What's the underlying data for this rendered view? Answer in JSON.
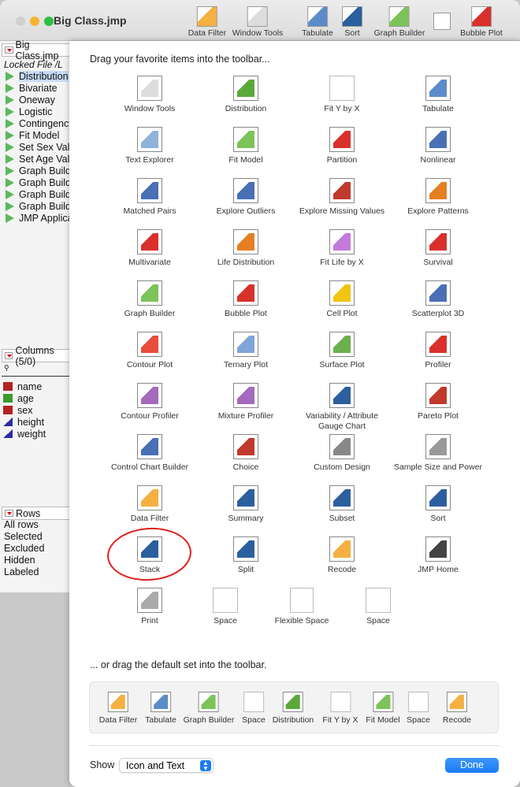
{
  "window": {
    "title": "Big Class.jmp"
  },
  "toolbar": [
    {
      "label": "Data Filter",
      "color": "#f5b042"
    },
    {
      "label": "Window Tools",
      "color": "#dddddd"
    },
    {
      "label": "Tabulate",
      "color": "#5b8cc9"
    },
    {
      "label": "Sort",
      "color": "#2c5f9e"
    },
    {
      "label": "Graph Builder",
      "color": "#7cc35a"
    },
    {
      "label": "",
      "color": "#ffffff"
    },
    {
      "label": "Bubble Plot",
      "color": "#d9302c"
    }
  ],
  "left": {
    "table_title": "Big Class.jmp",
    "locked": "Locked File  /L",
    "scripts": [
      "Distribution",
      "Bivariate",
      "Oneway",
      "Logistic",
      "Contingency",
      "Fit Model",
      "Set Sex Value",
      "Set Age Value",
      "Graph Builder",
      "Graph Builder",
      "Graph Builder",
      "Graph Builder",
      "JMP Application"
    ],
    "columns_title": "Columns (5/0)",
    "columns": [
      {
        "name": "name",
        "type": "nominal"
      },
      {
        "name": "age",
        "type": "ordinal"
      },
      {
        "name": "sex",
        "type": "nominal"
      },
      {
        "name": "height",
        "type": "continuous"
      },
      {
        "name": "weight",
        "type": "continuous"
      }
    ],
    "rows_title": "Rows",
    "rows": [
      "All rows",
      "Selected",
      "Excluded",
      "Hidden",
      "Labeled"
    ]
  },
  "sheet": {
    "drag_hint": "Drag your favorite items into the toolbar...",
    "items": [
      {
        "label": "Window Tools",
        "color": "#dddddd"
      },
      {
        "label": "Distribution",
        "color": "#5aa83a"
      },
      {
        "label": "Fit Y by X",
        "color": "#ffffff"
      },
      {
        "label": "Tabulate",
        "color": "#5b8cc9"
      },
      {
        "label": "Text Explorer",
        "color": "#8fb3d9"
      },
      {
        "label": "Fit Model",
        "color": "#7cc35a"
      },
      {
        "label": "Partition",
        "color": "#d9302c"
      },
      {
        "label": "Nonlinear",
        "color": "#4a6fb5"
      },
      {
        "label": "Matched Pairs",
        "color": "#4a6fb5"
      },
      {
        "label": "Explore Outliers",
        "color": "#4a6fb5"
      },
      {
        "label": "Explore Missing Values",
        "color": "#c0392b"
      },
      {
        "label": "Explore Patterns",
        "color": "#e67e22"
      },
      {
        "label": "Multivariate",
        "color": "#d9302c"
      },
      {
        "label": "Life Distribution",
        "color": "#e67e22"
      },
      {
        "label": "Fit Life by X",
        "color": "#c37ad9"
      },
      {
        "label": "Survival",
        "color": "#d9302c"
      },
      {
        "label": "Graph Builder",
        "color": "#7cc35a"
      },
      {
        "label": "Bubble Plot",
        "color": "#d9302c"
      },
      {
        "label": "Cell Plot",
        "color": "#f1c40f"
      },
      {
        "label": "Scatterplot 3D",
        "color": "#4a6fb5"
      },
      {
        "label": "Contour Plot",
        "color": "#e74c3c"
      },
      {
        "label": "Ternary Plot",
        "color": "#7fa6d9"
      },
      {
        "label": "Surface Plot",
        "color": "#6ab04c"
      },
      {
        "label": "Profiler",
        "color": "#d9302c"
      },
      {
        "label": "Contour Profiler",
        "color": "#a569bd"
      },
      {
        "label": "Mixture Profiler",
        "color": "#a569bd"
      },
      {
        "label": "Variability / Attribute Gauge Chart",
        "color": "#2c5f9e"
      },
      {
        "label": "Pareto Plot",
        "color": "#c0392b"
      },
      {
        "label": "Control Chart Builder",
        "color": "#4a6fb5"
      },
      {
        "label": "Choice",
        "color": "#c0392b"
      },
      {
        "label": "Custom Design",
        "color": "#888888"
      },
      {
        "label": "Sample Size and Power",
        "color": "#999999"
      },
      {
        "label": "Data Filter",
        "color": "#f5b042"
      },
      {
        "label": "Summary",
        "color": "#2c5f9e"
      },
      {
        "label": "Subset",
        "color": "#2c5f9e"
      },
      {
        "label": "Sort",
        "color": "#2c5f9e"
      },
      {
        "label": "Stack",
        "color": "#2c5f9e"
      },
      {
        "label": "Split",
        "color": "#2c5f9e"
      },
      {
        "label": "Recode",
        "color": "#f5b042"
      },
      {
        "label": "JMP Home",
        "color": "#444444"
      }
    ],
    "extras": [
      {
        "label": "Print",
        "color": "#aaaaaa"
      },
      {
        "label": "Space",
        "color": "#ffffff"
      },
      {
        "label": "Flexible Space",
        "color": "#ffffff"
      },
      {
        "label": "Space",
        "color": "#ffffff"
      }
    ],
    "default_hint": "... or drag the default set into the toolbar.",
    "default_set": [
      {
        "label": "Data Filter",
        "color": "#f5b042"
      },
      {
        "label": "Tabulate",
        "color": "#5b8cc9"
      },
      {
        "label": "Graph Builder",
        "color": "#7cc35a"
      },
      {
        "label": "Space",
        "color": "#ffffff"
      },
      {
        "label": "Distribution",
        "color": "#5aa83a"
      },
      {
        "label": "Fit Y by X",
        "color": "#ffffff"
      },
      {
        "label": "Fit Model",
        "color": "#7cc35a"
      },
      {
        "label": "Space",
        "color": "#ffffff"
      },
      {
        "label": "Recode",
        "color": "#f5b042"
      }
    ],
    "show_label": "Show",
    "show_value": "Icon and Text",
    "done_label": "Done"
  }
}
